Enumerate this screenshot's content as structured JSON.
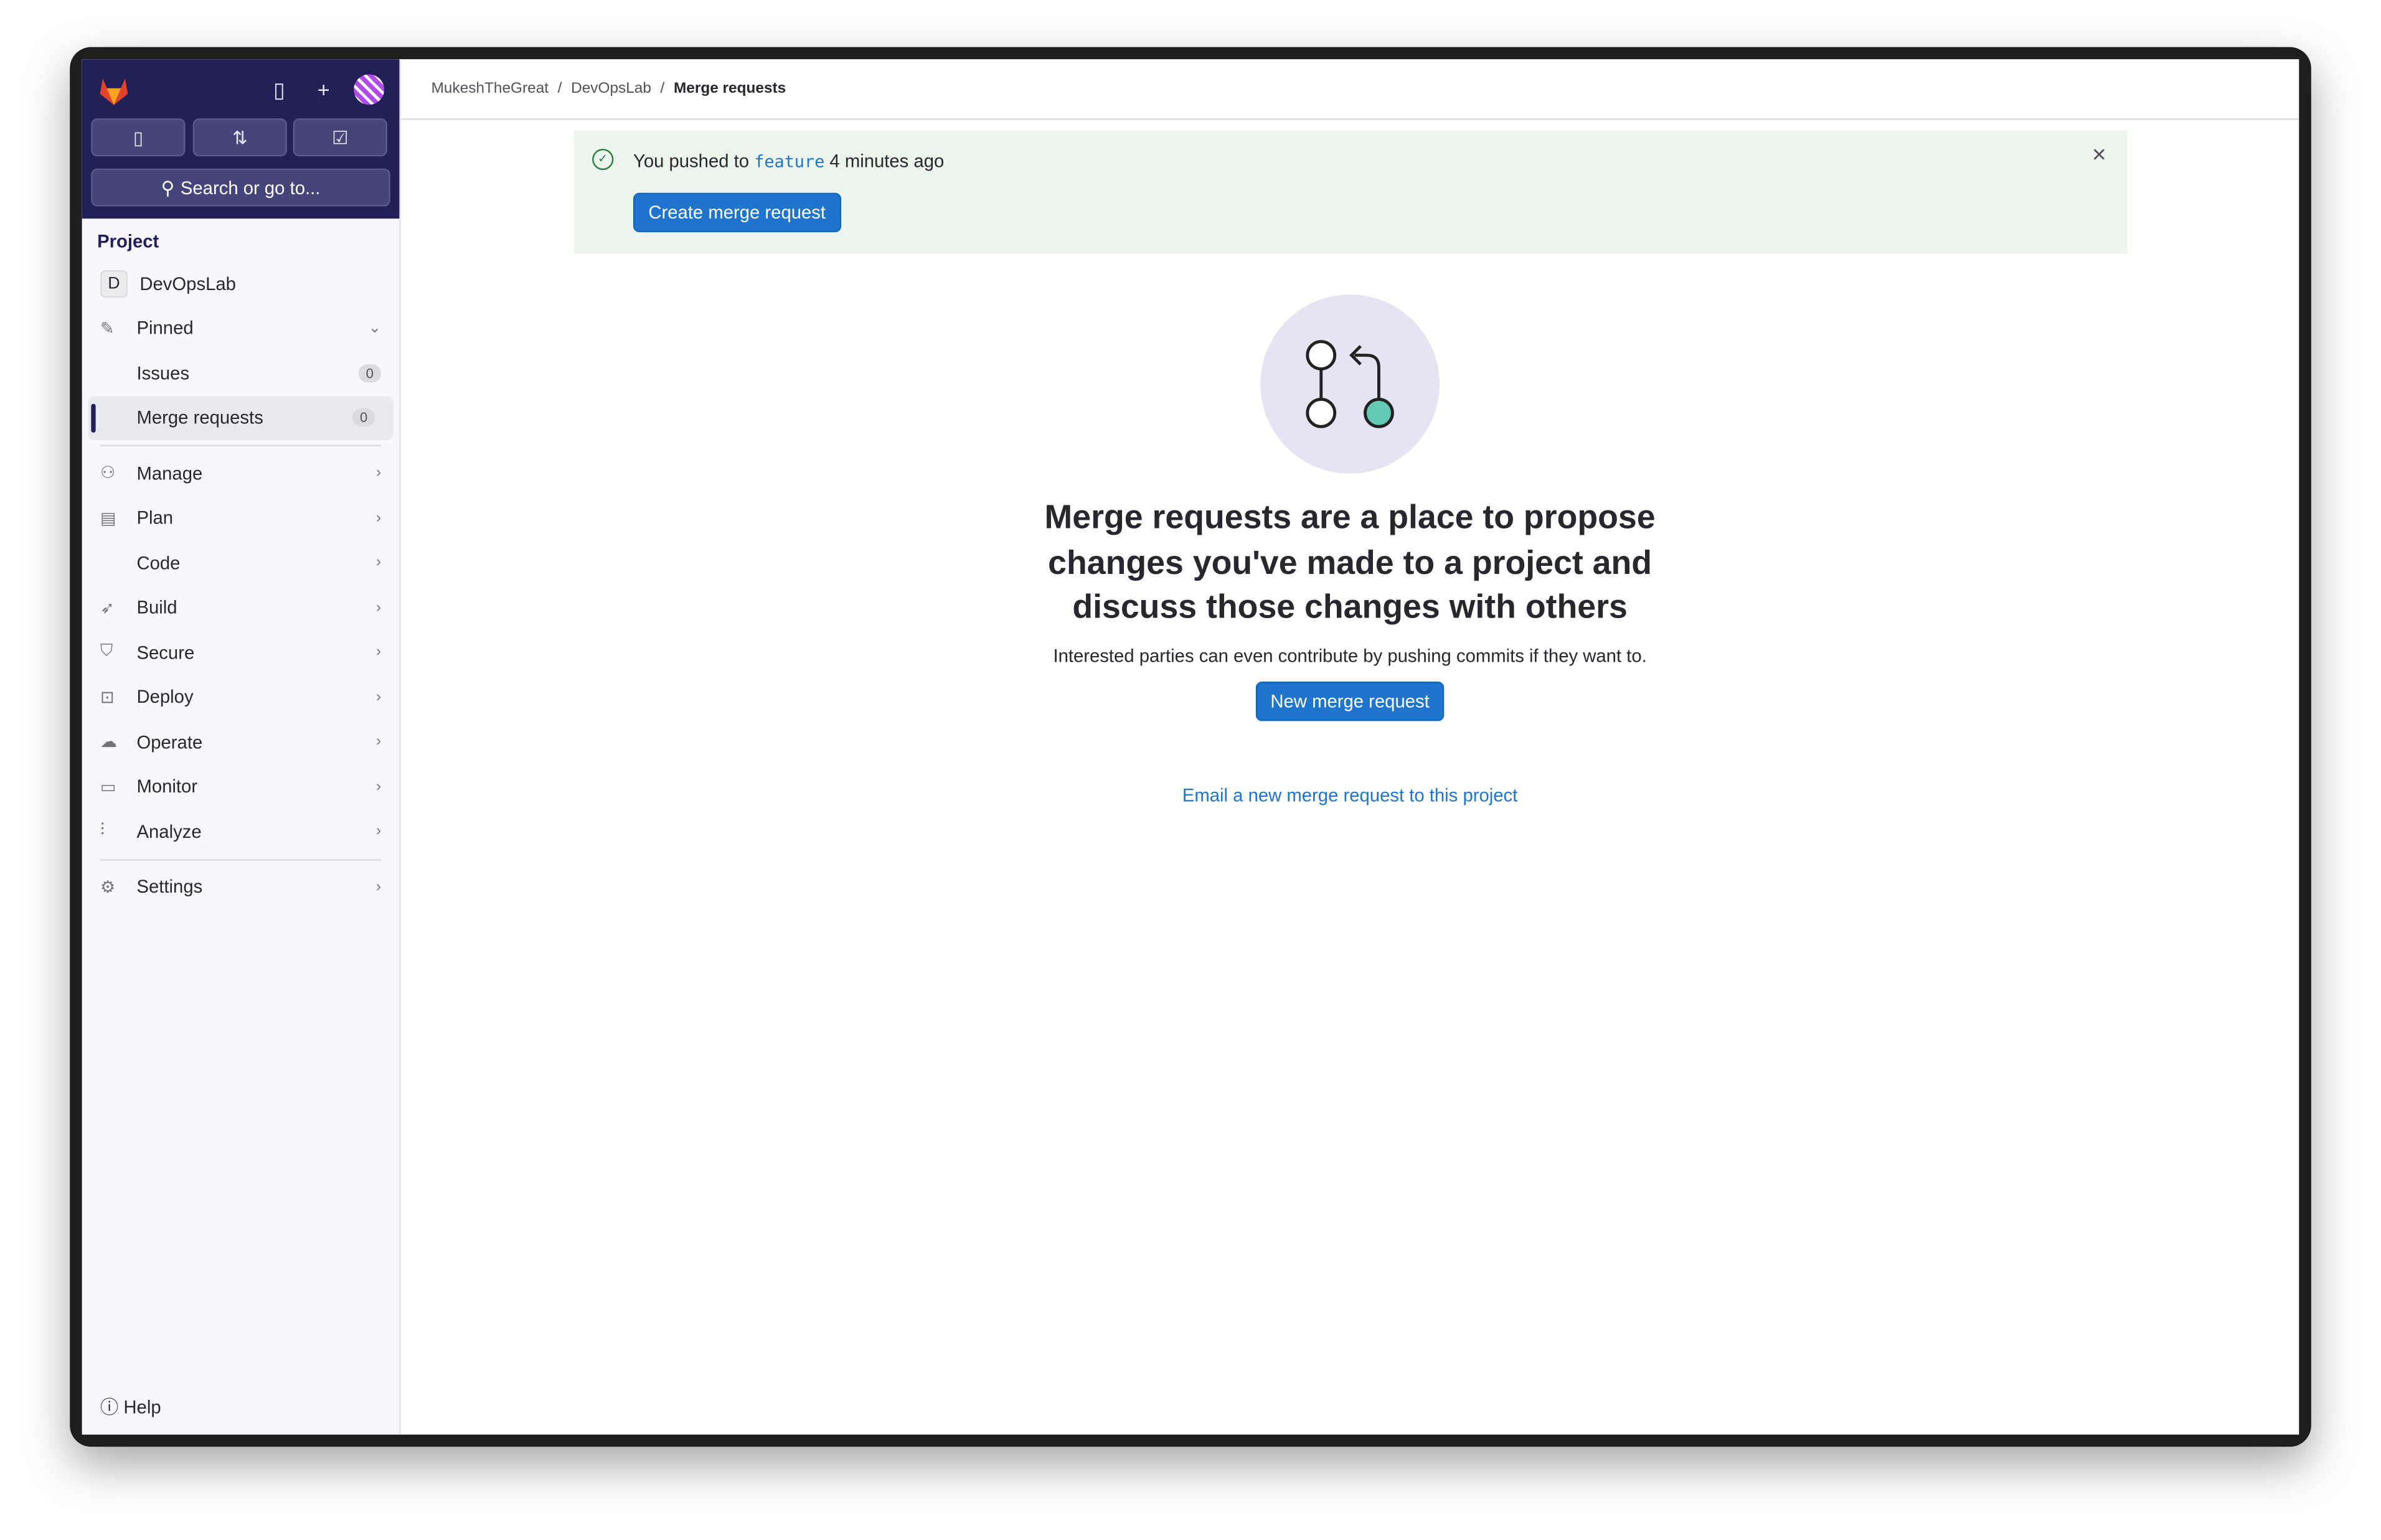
{
  "sidebar": {
    "search_label": "Search or go to...",
    "section_title": "Project",
    "project_initial": "D",
    "project_name": "DevOpsLab",
    "pinned_label": "Pinned",
    "pinned_items": [
      {
        "label": "Issues",
        "count": "0"
      },
      {
        "label": "Merge requests",
        "count": "0"
      }
    ],
    "nav_items": [
      {
        "label": "Manage",
        "icon": "users-icon"
      },
      {
        "label": "Plan",
        "icon": "calendar-icon"
      },
      {
        "label": "Code",
        "icon": "code-icon"
      },
      {
        "label": "Build",
        "icon": "rocket-icon"
      },
      {
        "label": "Secure",
        "icon": "shield-icon"
      },
      {
        "label": "Deploy",
        "icon": "deploy-icon"
      },
      {
        "label": "Operate",
        "icon": "cloud-icon"
      },
      {
        "label": "Monitor",
        "icon": "monitor-icon"
      },
      {
        "label": "Analyze",
        "icon": "chart-icon"
      }
    ],
    "settings_label": "Settings",
    "help_label": "Help"
  },
  "breadcrumb": [
    "MukeshTheGreat",
    "DevOpsLab",
    "Merge requests"
  ],
  "banner": {
    "prefix": "You pushed to",
    "branch": "feature",
    "suffix": "4 minutes ago",
    "button": "Create merge request"
  },
  "empty_state": {
    "title": "Merge requests are a place to propose changes you've made to a project and discuss those changes with others",
    "description": "Interested parties can even contribute by pushing commits if they want to.",
    "button": "New merge request",
    "email_link": "Email a new merge request to this project"
  },
  "colors": {
    "sidebar_top": "#222059",
    "primary": "#1f75cb",
    "banner_bg": "#ecf4ee"
  }
}
